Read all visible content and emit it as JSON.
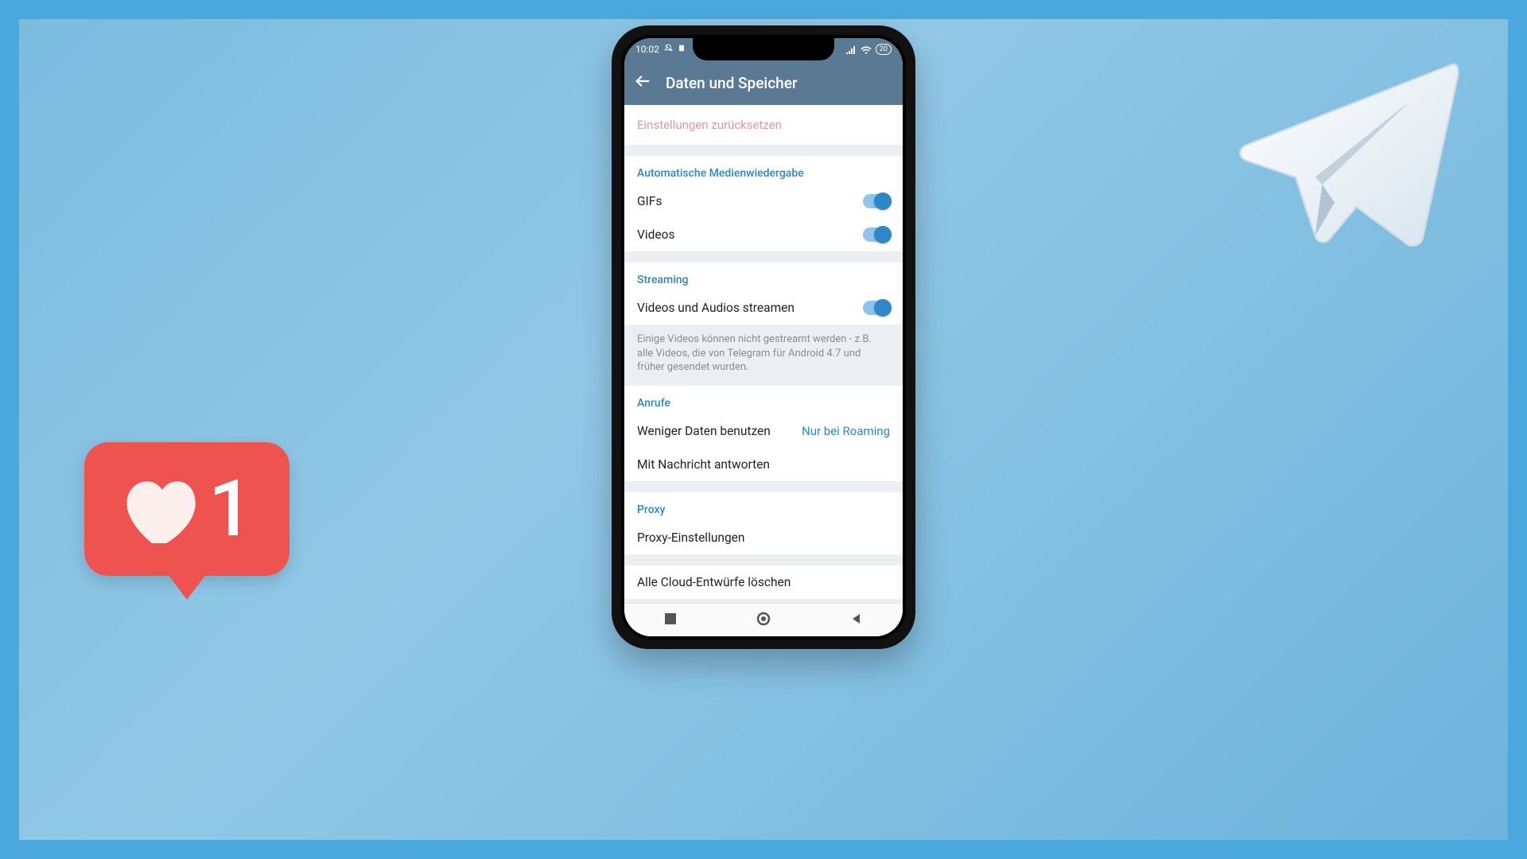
{
  "status": {
    "time": "10:02",
    "battery": "20"
  },
  "header": {
    "title": "Daten und Speicher"
  },
  "reset": {
    "label": "Einstellungen zurücksetzen"
  },
  "autoMedia": {
    "heading": "Automatische Medienwiedergabe",
    "gifs": "GIFs",
    "videos": "Videos"
  },
  "streaming": {
    "heading": "Streaming",
    "item": "Videos und Audios streamen",
    "hint": "Einige Videos können nicht gestreamt werden - z.B. alle Videos, die von Telegram für Android 4.7 und früher gesendet wurden."
  },
  "calls": {
    "heading": "Anrufe",
    "lessData": "Weniger Daten benutzen",
    "lessDataValue": "Nur bei Roaming",
    "replyWithMessage": "Mit Nachricht antworten"
  },
  "proxy": {
    "heading": "Proxy",
    "settings": "Proxy-Einstellungen"
  },
  "drafts": {
    "deleteAll": "Alle Cloud-Entwürfe löschen"
  },
  "badge": {
    "count": "1"
  }
}
